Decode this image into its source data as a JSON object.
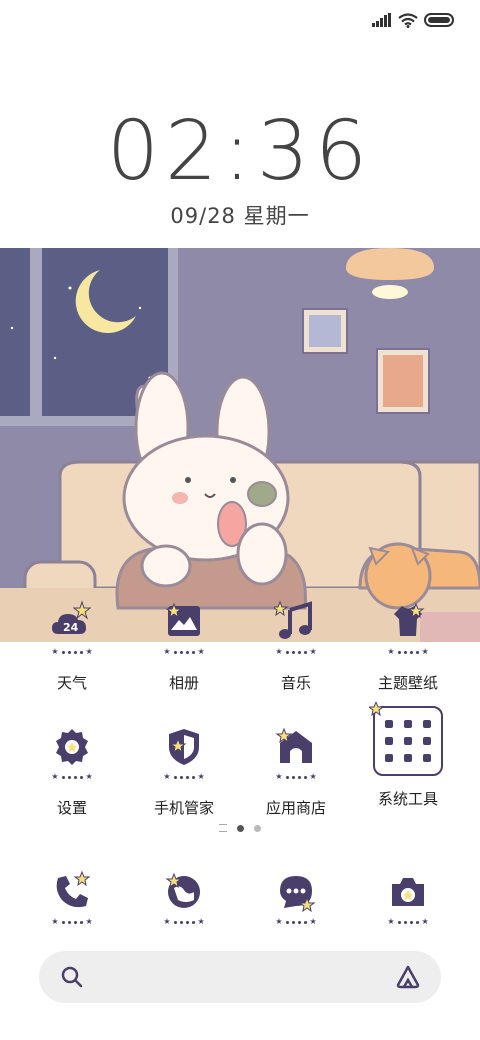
{
  "status_bar": {
    "signal_icon": "signal-icon",
    "wifi_icon": "wifi-icon",
    "battery_icon": "battery-icon"
  },
  "lockclock": {
    "time": "02:36",
    "date": "09/28 星期一"
  },
  "home_rows": [
    [
      {
        "label": "天气",
        "icon": "weather-icon",
        "badge": "24"
      },
      {
        "label": "相册",
        "icon": "gallery-icon"
      },
      {
        "label": "音乐",
        "icon": "music-icon"
      },
      {
        "label": "主题壁纸",
        "icon": "themes-icon"
      }
    ],
    [
      {
        "label": "设置",
        "icon": "settings-icon"
      },
      {
        "label": "手机管家",
        "icon": "security-icon"
      },
      {
        "label": "应用商店",
        "icon": "app-store-icon"
      },
      {
        "label": "系统工具",
        "icon": "folder-icon"
      }
    ]
  ],
  "pager": {
    "pages": 3,
    "active": 1
  },
  "dock": [
    {
      "icon": "phone-icon"
    },
    {
      "icon": "browser-icon"
    },
    {
      "icon": "messages-icon"
    },
    {
      "icon": "camera-icon"
    }
  ],
  "search_bar": {
    "search_icon": "search-icon",
    "assistant_icon": "assistant-icon"
  },
  "colors": {
    "icon_purple": "#4a3e6a",
    "star_yellow": "#f7e27a",
    "wall_purple": "#8c88a6",
    "sofa": "#efd8bd"
  }
}
